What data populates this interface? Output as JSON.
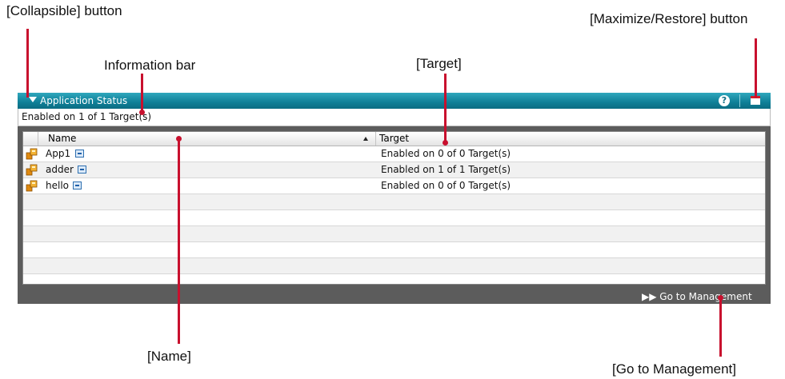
{
  "callouts": {
    "collapsible": "[Collapsible]  button",
    "maximize": "[Maximize/Restore]   button",
    "information_bar": "Information bar",
    "target": "[Target]",
    "name": "[Name]",
    "go_to_management": "[Go to Management]"
  },
  "portlet": {
    "title": "Application Status",
    "help_icon": "?",
    "info": "Enabled on 1 of 1 Target(s)",
    "columns": {
      "name": "Name",
      "target": "Target"
    },
    "rows": [
      {
        "name": "App1",
        "target": "Enabled on 0 of 0 Target(s)"
      },
      {
        "name": "adder",
        "target": "Enabled on 1 of 1 Target(s)"
      },
      {
        "name": "hello",
        "target": "Enabled on 0 of 0 Target(s)"
      }
    ],
    "footer_link": "Go to Management"
  },
  "colors": {
    "title_bar": "#0f7f97",
    "frame": "#5c5c5c",
    "callout_line": "#c8102e"
  }
}
